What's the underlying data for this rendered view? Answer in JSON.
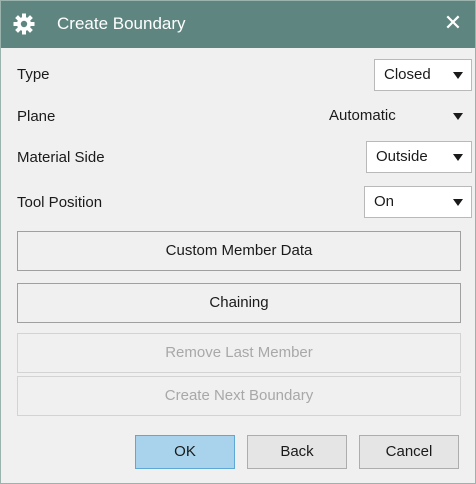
{
  "window": {
    "title": "Create Boundary",
    "title_icon": "gear-icon",
    "close_icon": "close-icon",
    "close_glyph": "✕"
  },
  "fields": {
    "type": {
      "label": "Type",
      "value": "Closed"
    },
    "plane": {
      "label": "Plane",
      "value": "Automatic"
    },
    "material_side": {
      "label": "Material Side",
      "value": "Outside"
    },
    "tool_position": {
      "label": "Tool Position",
      "value": "On"
    }
  },
  "buttons": {
    "custom_member_data": "Custom Member Data",
    "chaining": "Chaining",
    "remove_last_member": "Remove Last Member",
    "create_next_boundary": "Create Next Boundary",
    "ok": "OK",
    "back": "Back",
    "cancel": "Cancel"
  },
  "colors": {
    "titlebar": "#5e8580",
    "primary_button": "#a9d3ec",
    "disabled_text": "#a8a8a8"
  }
}
